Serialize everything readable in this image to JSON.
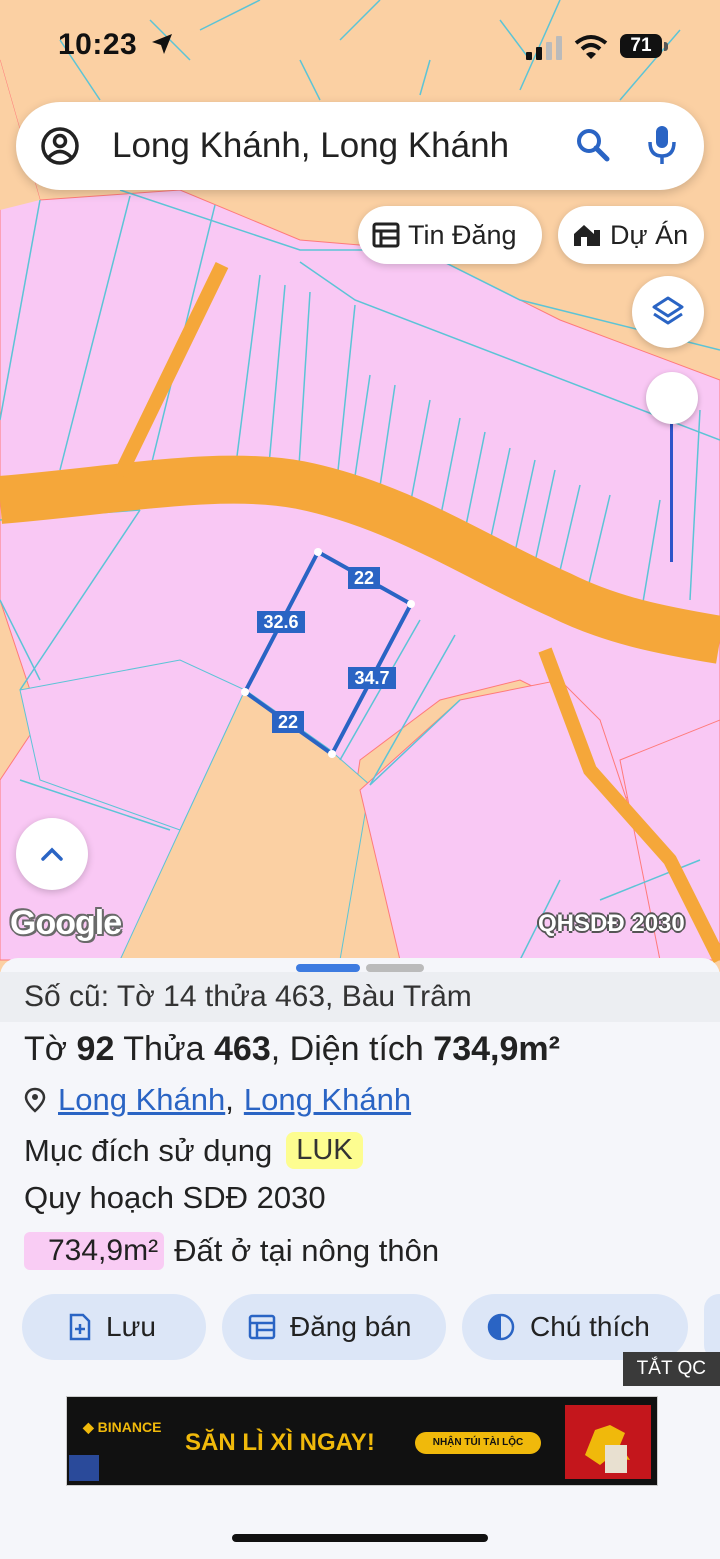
{
  "status_bar": {
    "time": "10:23",
    "battery": "71"
  },
  "search": {
    "query": "Long Khánh, Long Khánh"
  },
  "chips": {
    "listings": "Tin Đăng",
    "projects": "Dự Án"
  },
  "map": {
    "edge_labels": [
      "22",
      "32.6",
      "34.7",
      "22"
    ],
    "branding": "Google",
    "layer_label": "QHSDĐ 2030"
  },
  "parcel": {
    "old_reference": "Số cũ: Tờ 14 thửa 463, Bàu Trâm",
    "sheet_label": "Tờ",
    "sheet_no": "92",
    "plot_label": "Thửa",
    "plot_no": "463",
    "area_label": "Diện tích",
    "area": "734,9m²",
    "location_1": "Long Khánh",
    "location_sep": ",",
    "location_2": "Long Khánh",
    "purpose_label": "Mục đích sử dụng",
    "purpose_code": "LUK",
    "plan_label": "Quy hoạch SDĐ 2030",
    "zone_area": "734,9m²",
    "zone_name": "Đất ở tại nông thôn"
  },
  "actions": {
    "save": "Lưu",
    "post": "Đăng bán",
    "legend": "Chú thích"
  },
  "ads": {
    "hide_label": "TẮT QC",
    "brand": "BINANCE",
    "headline": "SĂN LÌ XÌ NGAY!",
    "cta": "NHẬN TÚI TÀI LỘC"
  },
  "colors": {
    "land_pink": "#f9c8f4",
    "land_peach": "#fbd0a3",
    "road_orange": "#f5a73a",
    "parcel_outline": "#2a64c4",
    "accent_blue": "#2a64c4"
  }
}
